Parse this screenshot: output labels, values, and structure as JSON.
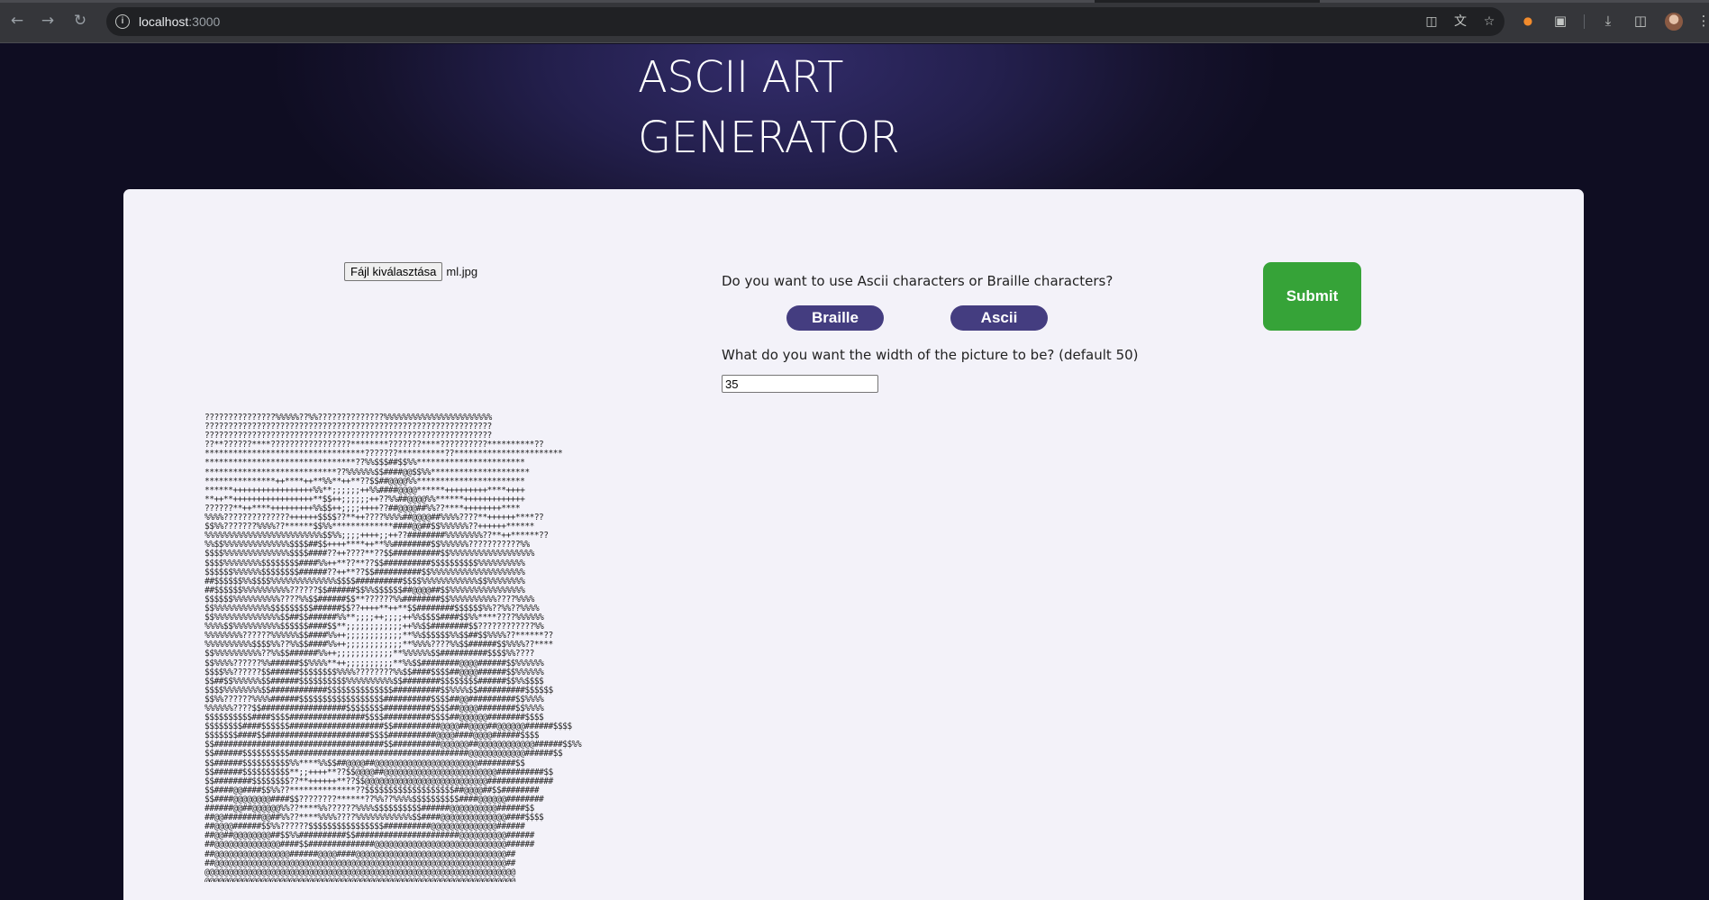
{
  "browser": {
    "url_host": "localhost",
    "url_port": ":3000",
    "icons": {
      "back": "back-arrow-icon",
      "forward": "forward-arrow-icon",
      "reload": "reload-icon",
      "site_info": "info-icon",
      "install": "install-app-icon",
      "translate": "translate-icon",
      "bookmark": "star-icon",
      "extension1": "extension-icon",
      "extensions": "puzzle-icon",
      "downloads": "download-icon",
      "side_panel": "side-panel-icon",
      "profile": "avatar",
      "menu": "kebab-menu-icon"
    }
  },
  "header": {
    "title_line1": "ASCII ART",
    "title_line2": "GENERATOR"
  },
  "form": {
    "file_button_label": "Fájl kiválasztása",
    "file_name": "ml.jpg",
    "charset_question": "Do you want to use Ascii characters or Braille characters?",
    "braille_label": "Braille",
    "ascii_label": "Ascii",
    "width_question": "What do you want the width of the picture to be? (default 50)",
    "width_value": "35",
    "submit_label": "Submit"
  },
  "output": {
    "ascii_lines": [
      "???????????????%%%%%??%%??????????????%%%%%%%%%%%%%%%%%%%%%%%",
      "?????????????????????????????????????????????????????????????",
      "?????????????????????????????????????????????????????????????",
      "??**??????****?????????????????********???????****??????????**********??",
      "**********************************???????**********??***********************",
      "********************************??%%$$$##$$%%***********************",
      "****************************??%%%%%%$$####@@$$%%*********************",
      "***************++****++**%%**++**??$$##@@@@%%***********************",
      "******+++++++++++++++++%%**;;;;;;++%%####@@@@******+++++++++****++++",
      "**++**+++++++++++++++++**$$++;;;;;;++??%%##@@@@%%******+++++++++++++",
      "??????**++****+++++++++%%$$++;;;;++++??##@@@@##%%??****++++++++****",
      "%%%%??????????????++++++$$$$??**++????%%%%##@@@@##%%%%????**++++++****??",
      "$$%%???????%%%%??******$$%%*************####@@##$$%%%%%%??++++++******",
      "%%%%%%%%%%%%%%%%%%%%%%%%%$$%%;;;;++++;;++??########%%%%%%%%??**++******??",
      "%%$$%%%%%%%%%%%%%%$$$$##$$++++****++**%%########$$%%%%%%???????????%%",
      "$$$$%%%%%%%%%%%%%%$$$$####??++????**??$$##########$$%%%%%%%%%%%%%%%%%%",
      "$$$$%%%%%%%%$$$$$$$$####%%++**??**??$$##########$$$$$$$$$$%%%%%%%%%%",
      "$$$$$$%%%%%%$$$$$$$$######??++**??$$##########$$%%%%%%%%%%%%%%%%%%%%",
      "##$$$$$$%%$$$$%%%%%%%%%%%%%%$$$$##########$$$$%%%%%%%%%%%%$$%%%%%%%%",
      "##$$$$$$%%%%%%%%%%??????$$######$$%%$$$$$$##@@@@##$$%%%%%%%%%%%%%%%%",
      "$$$$$$%%%%%%%%%%????%%$$######$$**??????%%########$$%%%%%%%%%%????%%%%",
      "$$%%%%%%%%%%%%$$$$$$$$$######$$??++++**++**$$########$$$$$$%%??%%??%%%%",
      "$$%%%%%%%%%%%%%%$$##$$######%%**;;;;++;;;;++%%$$$$####$$%%****????%%%%%%",
      "%%%%$$%%%%%%%%%%$$$$$$####$$**;;;;;;;;;;;;++%%$$########$$????????????%%",
      "%%%%%%%%??????%%%%%%$$####%%++;;;;;;;;;;;;**%%$$$$$$%%$$##$$%%%%??******??",
      "%%%%%%%%%%$$$$%%??%%$$####%%++;;;;;;;;;;;;**%%%%????%%$$######$$%%%%??****",
      "$$%%%%%%%%%%??%%$$######%%++;;;;;;;;;;;;**%%%%%%$$##########$$$$%%????",
      "$$%%%%??????%%######$$%%%%**++;;;;;;;;;;**%%$$########@@@@######$$%%%%%%",
      "$$$$%%??????$$######$$$$$$$$%%%%????????%%$$####$$$$##@@@@######$$%%%%%%",
      "$$##$$%%%%%%$$######$$$$$$$$$$%%%%%%%%%%$$########$$$$$$$$######$$%%$$$$",
      "$$$$%%%%%%%%$$############$$$$$$$$$$$$$$##########$$%%%%$$##########$$$$$$",
      "$$%%??????%%%%######$$$$$$$$$$$$$$$$$$##########$$$$##@@##########$$%%%%",
      "%%%%%%????$$##################$$$$$$$$##########$$$$##@@@@########$$%%%%",
      "$$$$$$$$$$####$$$$################$$$$##########$$$$##@@@@@@########$$$$",
      "$$$$$$$$####$$$$$$####################$$##########@@@@##@@@@##@@@@@@######$$$$",
      "$$$$$$$####$$######################$$$$##########@@@@####@@@@######$$$$",
      "$$####################################$$##########@@@@@@##@@@@@@@@@@@@######$$%%",
      "$$######$$$$$$$$$$######################################@@@@@@@@@@@@######$$",
      "$$######$$$$$$$$$$%%****%%$$##@@@@##@@@@@@@@@@@@@@@@@@@@@@########$$",
      "$$######$$$$$$$$$$**;;++++**??$$@@@@##@@@@@@@@@@@@@@@@@@@@@@@@##########$$",
      "$$########$$$$$$$$??**++++++**??$$@@@@@@@@@@@@@@@@@@@@@@@@@@##############",
      "$$####@@####$$%%??**************??$$$$$$$$$$$$$$$$$$$##@@@@##$$########",
      "$$####@@@@@@@@####$$????????******??%%??%%%%$$$$$$$$$$####@@@@@@########",
      "######@@##@@@@@@%%??****%%??????%%%%$$$$$$$$$$######@@@@@@@@@@######$$",
      "##@@########@@##%%??****%%%%????%%%%%%%%%%%%$$####@@@@@@@@@@@@@@####$$$$",
      "##@@@@######$$%%??????$$$$$$$$$$$$$$$$##########@@@@@@@@@@@@@@######",
      "##@@##@@@@@@@@##$$%%##########$$######################@@@@@@@@@@######",
      "##@@@@@@@@@@@@@@####$$##############@@@@@@@@@@@@@@@@@@@@@@@@@@@@######",
      "##@@@@@@@@@@@@@@@@######@@@@####@@@@@@@@@@@@@@@@@@@@@@@@@@@@@@@@##",
      "##@@@@@@@@@@@@@@@@@@@@@@@@@@@@@@@@@@@@@@@@@@@@@@@@@@@@@@@@@@@@@@##",
      "@@@@@@@@@@@@@@@@@@@@@@@@@@@@@@@@@@@@@@@@@@@@@@@@@@@@@@@@@@@@@@@@@@",
      "@@@@@@@@@@@@@@@@@@@@@@@@@@@@@@@@@@@@@@@@@@@@@@@@@@@@@@@@@@@@@@@@@@"
    ]
  }
}
